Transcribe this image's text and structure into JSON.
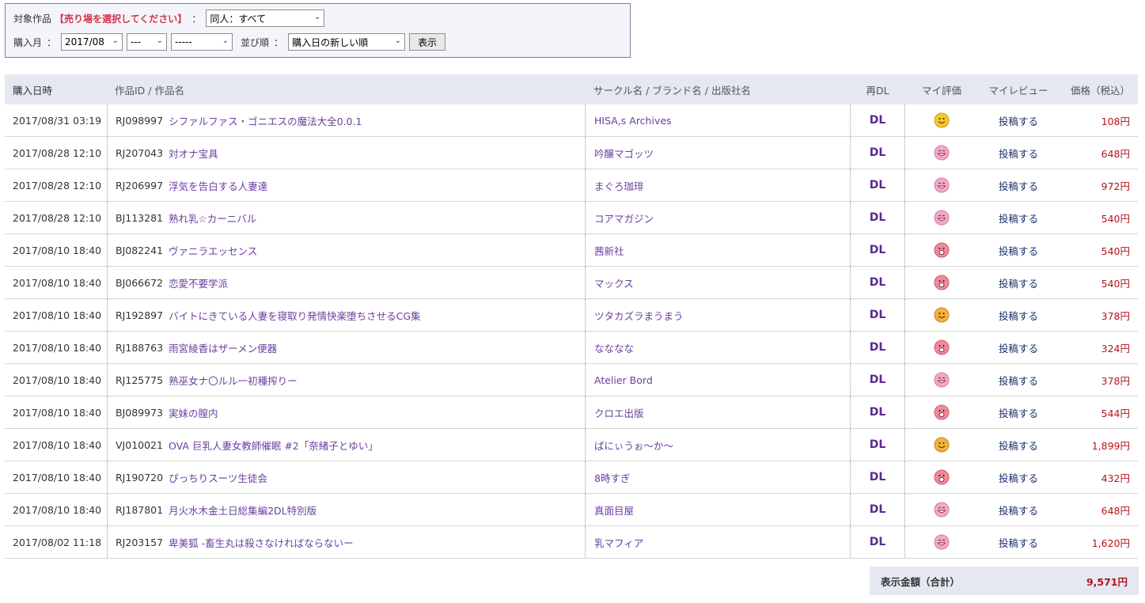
{
  "filter": {
    "target_label": "対象作品",
    "warning": "【売り場を選択してください】",
    "target_sep": "：",
    "target_value": "同人：すべて",
    "month_label": "購入月",
    "month_sep": "：",
    "month_value": "2017/08",
    "day_value": "---",
    "extra_value": "-----",
    "sort_label": "並び順",
    "sort_sep": "：",
    "sort_value": "購入日の新しい順",
    "show_button": "表示"
  },
  "table": {
    "headers": {
      "date": "購入日時",
      "work": "作品ID / 作品名",
      "circle": "サークル名 / ブランド名 / 出版社名",
      "redl": "再DL",
      "rating": "マイ評価",
      "review": "マイレビュー",
      "price": "価格（税込）"
    },
    "rows": [
      {
        "date": "2017/08/31 03:19",
        "id": "RJ098997",
        "name": "シファルファス・ゴニエスの魔法大全0.0.1",
        "circle": "HISA,s Archives",
        "dl": "DL",
        "rating": "smile-yellow",
        "review": "投稿する",
        "price": "108円"
      },
      {
        "date": "2017/08/28 12:10",
        "id": "RJ207043",
        "name": "対オナ宝具",
        "circle": "吟醸マゴッツ",
        "dl": "DL",
        "rating": "grin-pink",
        "review": "投稿する",
        "price": "648円"
      },
      {
        "date": "2017/08/28 12:10",
        "id": "RJ206997",
        "name": "浮気を告白する人妻達",
        "circle": "まぐろ珈琲",
        "dl": "DL",
        "rating": "grin-pink",
        "review": "投稿する",
        "price": "972円"
      },
      {
        "date": "2017/08/28 12:10",
        "id": "BJ113281",
        "name": "熟れ乳☆カーニバル",
        "circle": "コアマガジン",
        "dl": "DL",
        "rating": "grin-pink",
        "review": "投稿する",
        "price": "540円"
      },
      {
        "date": "2017/08/10 18:40",
        "id": "BJ082241",
        "name": "ヴァニラエッセンス",
        "circle": "茜新社",
        "dl": "DL",
        "rating": "laugh-red",
        "review": "投稿する",
        "price": "540円"
      },
      {
        "date": "2017/08/10 18:40",
        "id": "BJ066672",
        "name": "恋愛不要学派",
        "circle": "マックス",
        "dl": "DL",
        "rating": "laugh-red",
        "review": "投稿する",
        "price": "540円"
      },
      {
        "date": "2017/08/10 18:40",
        "id": "RJ192897",
        "name": "バイトにきている人妻を寝取り発情快楽堕ちさせるCG集",
        "circle": "ツタカズラまうまう",
        "dl": "DL",
        "rating": "smile-orange",
        "review": "投稿する",
        "price": "378円"
      },
      {
        "date": "2017/08/10 18:40",
        "id": "RJ188763",
        "name": "雨宮綾香はザーメン便器",
        "circle": "なななな",
        "dl": "DL",
        "rating": "laugh-red",
        "review": "投稿する",
        "price": "324円"
      },
      {
        "date": "2017/08/10 18:40",
        "id": "RJ125775",
        "name": "熟巫女ナ〇ルル一初種搾りー",
        "circle": "Atelier Bord",
        "dl": "DL",
        "rating": "grin-pink",
        "review": "投稿する",
        "price": "378円"
      },
      {
        "date": "2017/08/10 18:40",
        "id": "BJ089973",
        "name": "実妹の膣内",
        "circle": "クロエ出版",
        "dl": "DL",
        "rating": "laugh-red",
        "review": "投稿する",
        "price": "544円"
      },
      {
        "date": "2017/08/10 18:40",
        "id": "VJ010021",
        "name": "OVA 巨乳人妻女教師催眠 #2「奈緒子とゆい」",
        "circle": "ぱにぃうぉ〜か〜",
        "dl": "DL",
        "rating": "smile-orange",
        "review": "投稿する",
        "price": "1,899円"
      },
      {
        "date": "2017/08/10 18:40",
        "id": "RJ190720",
        "name": "ぴっちりスーツ生徒会",
        "circle": "8時すぎ",
        "dl": "DL",
        "rating": "laugh-red",
        "review": "投稿する",
        "price": "432円"
      },
      {
        "date": "2017/08/10 18:40",
        "id": "RJ187801",
        "name": "月火水木金土日総集編2DL特別版",
        "circle": "真面目屋",
        "dl": "DL",
        "rating": "grin-pink",
        "review": "投稿する",
        "price": "648円"
      },
      {
        "date": "2017/08/02 11:18",
        "id": "RJ203157",
        "name": "卑美狐 -畜生丸は殺さなければならないー",
        "circle": "乳マフィア",
        "dl": "DL",
        "rating": "grin-pink",
        "review": "投稿する",
        "price": "1,620円"
      }
    ]
  },
  "total": {
    "label": "表示金額（合計）",
    "value": "9,571円"
  },
  "colors": {
    "header_bg": "#e5e8f1",
    "link_purple": "#6a3ea0",
    "price_red": "#b3151c",
    "warning_red": "#d0384a"
  }
}
